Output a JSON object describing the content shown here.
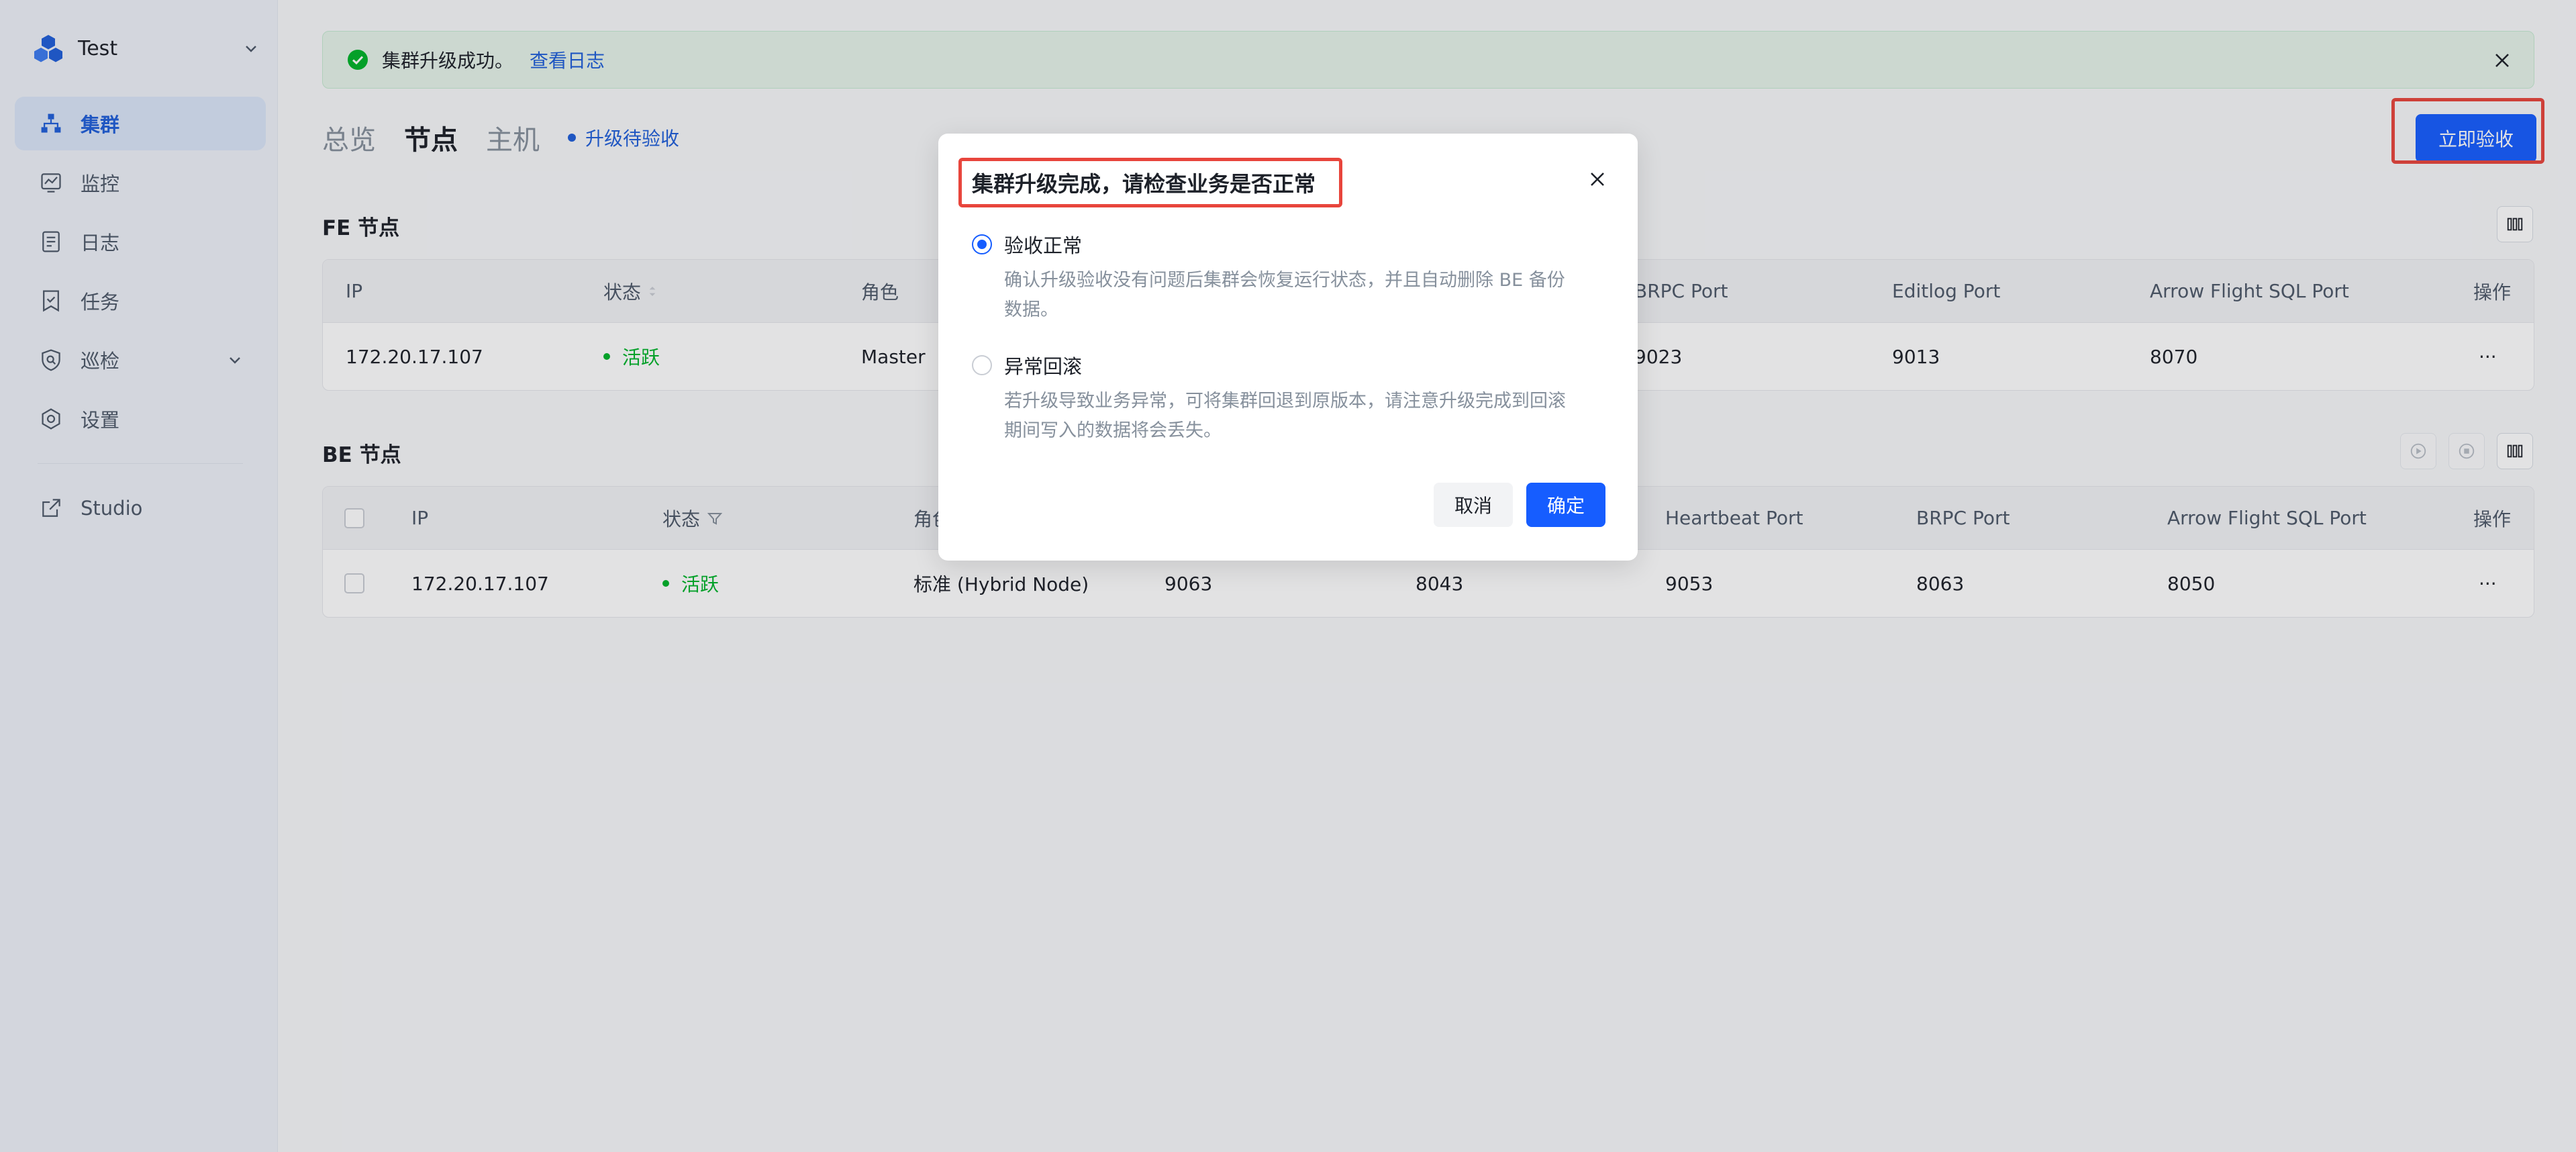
{
  "sidebar": {
    "workspace_name": "Test",
    "items": [
      {
        "label": "集群",
        "icon": "cluster-icon"
      },
      {
        "label": "监控",
        "icon": "monitor-icon"
      },
      {
        "label": "日志",
        "icon": "log-icon"
      },
      {
        "label": "任务",
        "icon": "task-icon"
      },
      {
        "label": "巡检",
        "icon": "inspection-icon"
      },
      {
        "label": "设置",
        "icon": "settings-icon"
      },
      {
        "label": "Studio",
        "icon": "external-link-icon"
      }
    ]
  },
  "alert": {
    "message": "集群升级成功。",
    "link": "查看日志"
  },
  "tabs": {
    "overview": "总览",
    "nodes": "节点",
    "hosts": "主机",
    "pending": "升级待验收"
  },
  "accept_button": "立即验收",
  "fe": {
    "title": "FE 节点",
    "headers": [
      "IP",
      "状态",
      "角色",
      "BRPC Port",
      "Editlog Port",
      "Arrow Flight SQL Port",
      "操作"
    ],
    "rows": [
      {
        "ip": "172.20.17.107",
        "status": "活跃",
        "role": "Master",
        "brpc": "9023",
        "editlog": "9013",
        "arrow": "8070",
        "more": "···"
      }
    ]
  },
  "be": {
    "title": "BE 节点",
    "headers": [
      "IP",
      "状态",
      "角色",
      "Heartbeat Port",
      "BRPC Port",
      "Arrow Flight SQL Port",
      "操作"
    ],
    "rows": [
      {
        "ip": "172.20.17.107",
        "status": "活跃",
        "role": "标准 (Hybrid Node)",
        "port1": "9063",
        "port2": "8043",
        "heartbeat": "9053",
        "brpc": "8063",
        "arrow": "8050",
        "more": "···"
      }
    ]
  },
  "modal": {
    "title": "集群升级完成，请检查业务是否正常",
    "option1_label": "验收正常",
    "option1_desc": "确认升级验收没有问题后集群会恢复运行状态，并且自动删除 BE 备份数据。",
    "option2_label": "异常回滚",
    "option2_desc": "若升级导致业务异常，可将集群回退到原版本，请注意升级完成到回滚期间写入的数据将会丢失。",
    "cancel": "取消",
    "confirm": "确定"
  },
  "colors": {
    "primary": "#165dff",
    "success": "#00b42a",
    "highlight": "#e8453c"
  }
}
